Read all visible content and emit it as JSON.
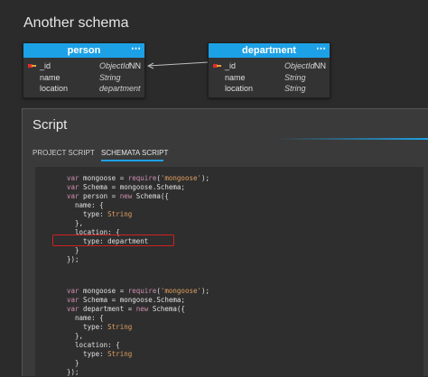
{
  "diagram": {
    "title": "Another schema",
    "entities": [
      {
        "name": "person",
        "menu_glyph": "⋯",
        "fields": [
          {
            "name": "_id",
            "type": "ObjectId",
            "nn": "NN",
            "key": true
          },
          {
            "name": "name",
            "type": "String",
            "nn": "",
            "key": false
          },
          {
            "name": "location",
            "type": "department",
            "nn": "",
            "key": false
          }
        ]
      },
      {
        "name": "department",
        "menu_glyph": "⋯",
        "fields": [
          {
            "name": "_id",
            "type": "ObjectId",
            "nn": "NN",
            "key": true
          },
          {
            "name": "name",
            "type": "String",
            "nn": "",
            "key": false
          },
          {
            "name": "location",
            "type": "String",
            "nn": "",
            "key": false
          }
        ]
      }
    ],
    "accent_color": "#1da1e6",
    "key_icon": "key-icon"
  },
  "panel": {
    "title": "Script",
    "tabs": [
      {
        "label": "PROJECT SCRIPT",
        "active": false
      },
      {
        "label": "SCHEMATA SCRIPT",
        "active": true
      }
    ]
  },
  "code": {
    "blocks": [
      {
        "lines": [
          [
            {
              "t": "var",
              "c": "kw"
            },
            {
              "t": " mongoose = "
            },
            {
              "t": "require",
              "c": "kw"
            },
            {
              "t": "("
            },
            {
              "t": "'mongoose'",
              "c": "str"
            },
            {
              "t": ");"
            }
          ],
          [
            {
              "t": "var",
              "c": "kw"
            },
            {
              "t": " Schema = mongoose.Schema;"
            }
          ],
          [
            {
              "t": "var",
              "c": "kw"
            },
            {
              "t": " person = "
            },
            {
              "t": "new",
              "c": "kw"
            },
            {
              "t": " Schema({"
            }
          ],
          [
            {
              "t": "  name: {"
            }
          ],
          [
            {
              "t": "    type: "
            },
            {
              "t": "String",
              "c": "str"
            }
          ],
          [
            {
              "t": "  },"
            }
          ],
          [
            {
              "t": "  location: {"
            }
          ],
          [
            {
              "t": "    type: department"
            }
          ],
          [
            {
              "t": "  }"
            }
          ],
          [
            {
              "t": "});"
            }
          ]
        ]
      },
      {
        "lines": [
          [
            {
              "t": "var",
              "c": "kw"
            },
            {
              "t": " mongoose = "
            },
            {
              "t": "require",
              "c": "kw"
            },
            {
              "t": "("
            },
            {
              "t": "'mongoose'",
              "c": "str"
            },
            {
              "t": ");"
            }
          ],
          [
            {
              "t": "var",
              "c": "kw"
            },
            {
              "t": " Schema = mongoose.Schema;"
            }
          ],
          [
            {
              "t": "var",
              "c": "kw"
            },
            {
              "t": " department = "
            },
            {
              "t": "new",
              "c": "kw"
            },
            {
              "t": " Schema({"
            }
          ],
          [
            {
              "t": "  name: {"
            }
          ],
          [
            {
              "t": "    type: "
            },
            {
              "t": "String",
              "c": "str"
            }
          ],
          [
            {
              "t": "  },"
            }
          ],
          [
            {
              "t": "  location: {"
            }
          ],
          [
            {
              "t": "    type: "
            },
            {
              "t": "String",
              "c": "str"
            }
          ],
          [
            {
              "t": "  }"
            }
          ],
          [
            {
              "t": "});"
            }
          ]
        ]
      }
    ],
    "highlight_color": "#d42020"
  }
}
